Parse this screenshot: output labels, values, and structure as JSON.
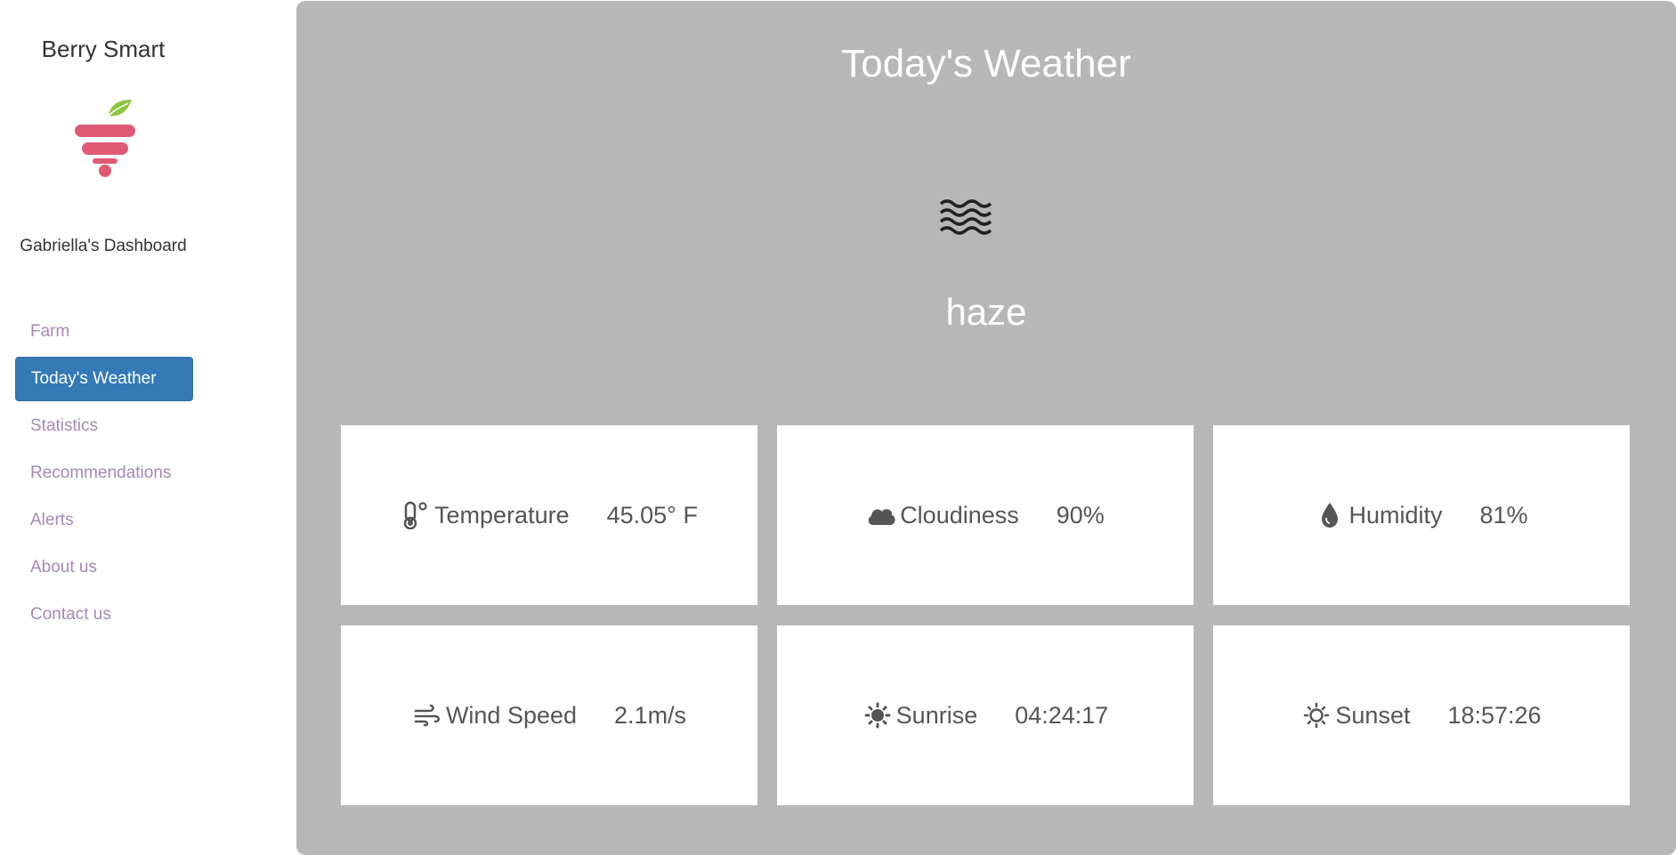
{
  "sidebar": {
    "brand": "Berry Smart",
    "logo": "berry-smart-logo",
    "dashboard_title": "Gabriella's Dashboard",
    "items": [
      {
        "label": "Farm",
        "active": false
      },
      {
        "label": "Today's Weather",
        "active": true
      },
      {
        "label": "Statistics",
        "active": false
      },
      {
        "label": "Recommendations",
        "active": false
      },
      {
        "label": "Alerts",
        "active": false
      },
      {
        "label": "About us",
        "active": false
      },
      {
        "label": "Contact us",
        "active": false
      }
    ]
  },
  "main": {
    "title": "Today's Weather",
    "condition_icon": "haze-icon",
    "condition": "haze",
    "cards": [
      {
        "icon": "thermometer-icon",
        "label": "Temperature",
        "value": "45.05° F"
      },
      {
        "icon": "cloud-icon",
        "label": "Cloudiness",
        "value": "90%"
      },
      {
        "icon": "droplet-icon",
        "label": "Humidity",
        "value": "81%"
      },
      {
        "icon": "wind-icon",
        "label": "Wind Speed",
        "value": "2.1m/s"
      },
      {
        "icon": "sunrise-icon",
        "label": "Sunrise",
        "value": "04:24:17"
      },
      {
        "icon": "sunset-icon",
        "label": "Sunset",
        "value": "18:57:26"
      }
    ]
  },
  "colors": {
    "main_bg": "#b7b7b7",
    "active_nav_bg": "#337ab7",
    "nav_link": "#a688b6",
    "logo_berry": "#e05a74",
    "logo_leaf": "#8cc63f"
  }
}
